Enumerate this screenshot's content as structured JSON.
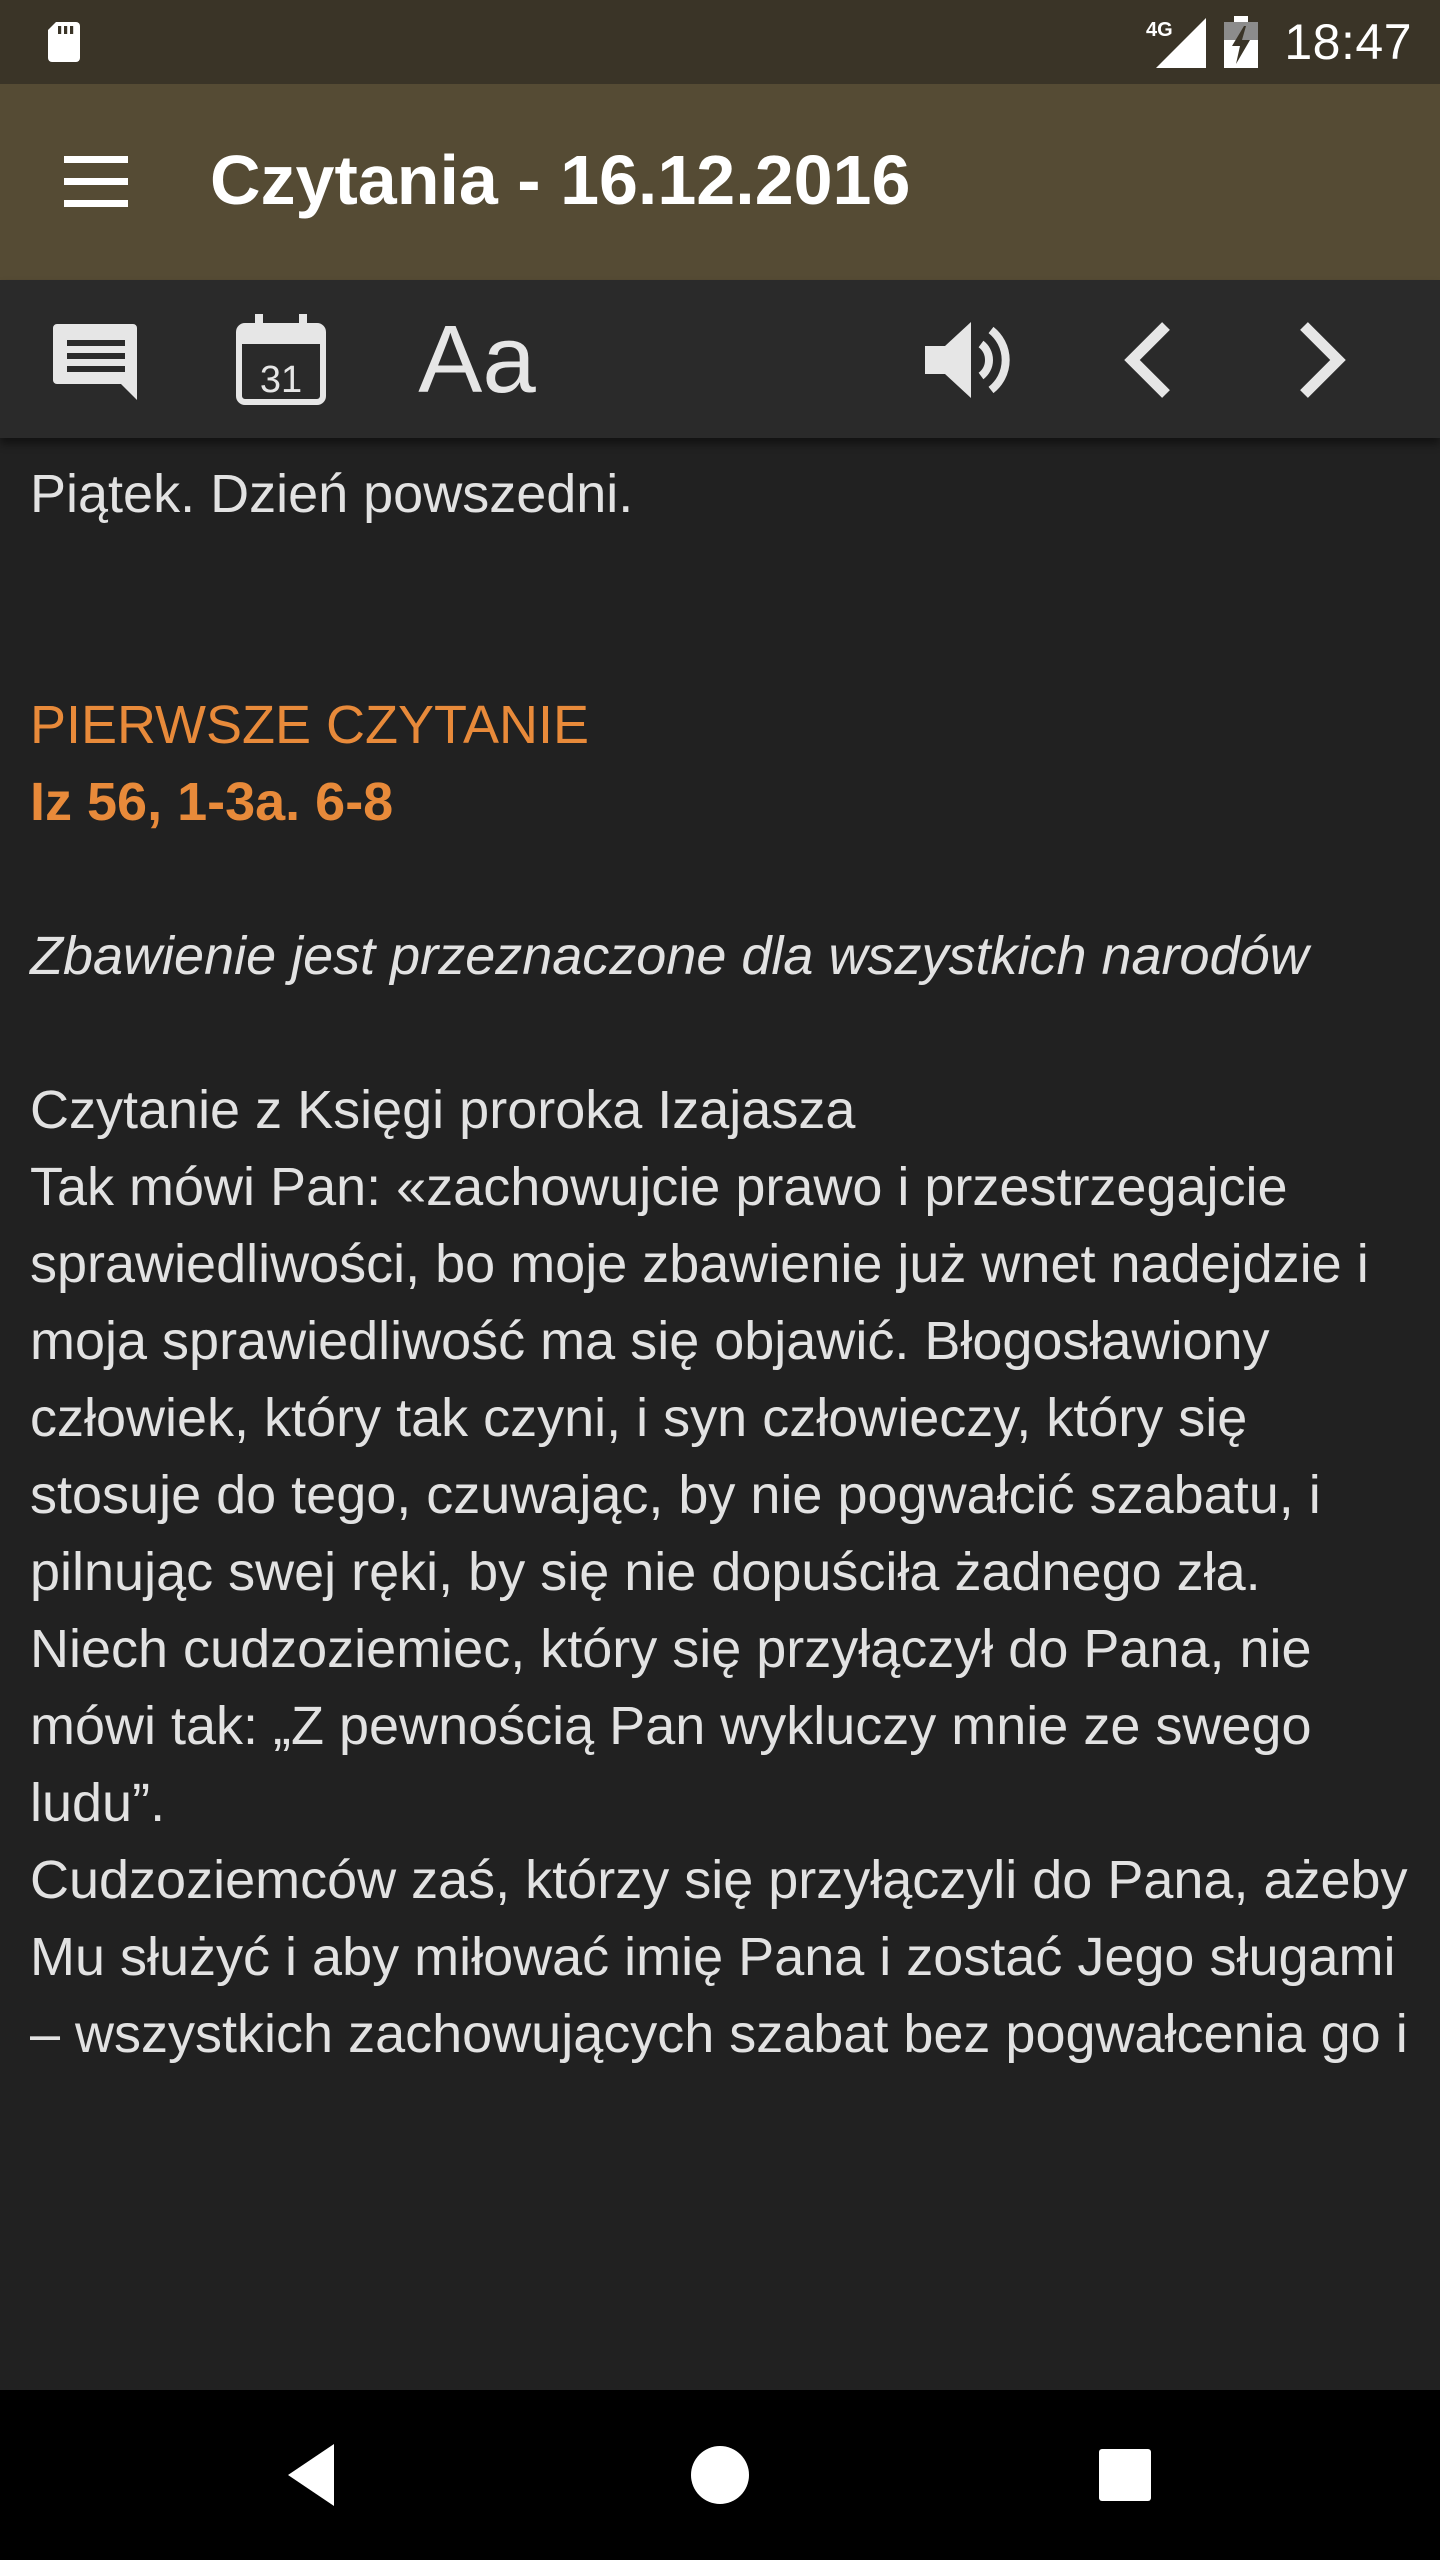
{
  "status_bar": {
    "network": "4G",
    "time": "18:47"
  },
  "app_bar": {
    "title": "Czytania - 16.12.2016"
  },
  "toolbar": {
    "font_size_label": "Aa",
    "calendar_day": "31"
  },
  "content": {
    "day_label": "Piątek. Dzień powszedni.",
    "reading_heading": "PIERWSZE CZYTANIE",
    "reading_reference": "Iz 56, 1-3a. 6-8",
    "reading_subtitle": "Zbawienie jest przeznaczone dla wszystkich narodów",
    "reading_source": "Czytanie z Księgi proroka Izajasza",
    "paragraphs": [
      "Tak mówi Pan: «zachowujcie prawo i przestrzegajcie sprawiedliwości, bo moje zbawienie już wnet nadejdzie i moja sprawiedliwość ma się objawić. Błogosławiony człowiek, który tak czyni, i syn człowieczy, który się stosuje do tego, czuwając, by nie pogwałcić szabatu, i pilnując swej ręki, by się nie dopuściła żadnego zła.",
      "Niech cudzoziemiec, który się przyłączył do Pana, nie mówi tak: „Z pewnością Pan wykluczy mnie ze swego ludu”.",
      "Cudzoziemców zaś, którzy się przyłączyli do Pana, ażeby Mu służyć i aby miłować imię Pana i zostać Jego sługami – wszystkich zachowujących szabat bez pogwałcenia go i"
    ]
  },
  "colors": {
    "status_bar_bg": "#3a3427",
    "app_bar_bg": "#554b34",
    "toolbar_bg": "#2a2a2a",
    "content_bg": "#212121",
    "accent_orange": "#e88a3a",
    "text": "#e2e2e2"
  },
  "icons": {
    "status_bar": [
      "sd-card-icon",
      "signal-icon",
      "battery-charging-icon"
    ],
    "app_bar": [
      "hamburger-menu-icon"
    ],
    "toolbar": [
      "comment-icon",
      "calendar-icon",
      "font-size-icon",
      "volume-icon",
      "chevron-left-icon",
      "chevron-right-icon"
    ],
    "nav_bar": [
      "back-triangle-icon",
      "home-circle-icon",
      "recents-square-icon"
    ]
  }
}
